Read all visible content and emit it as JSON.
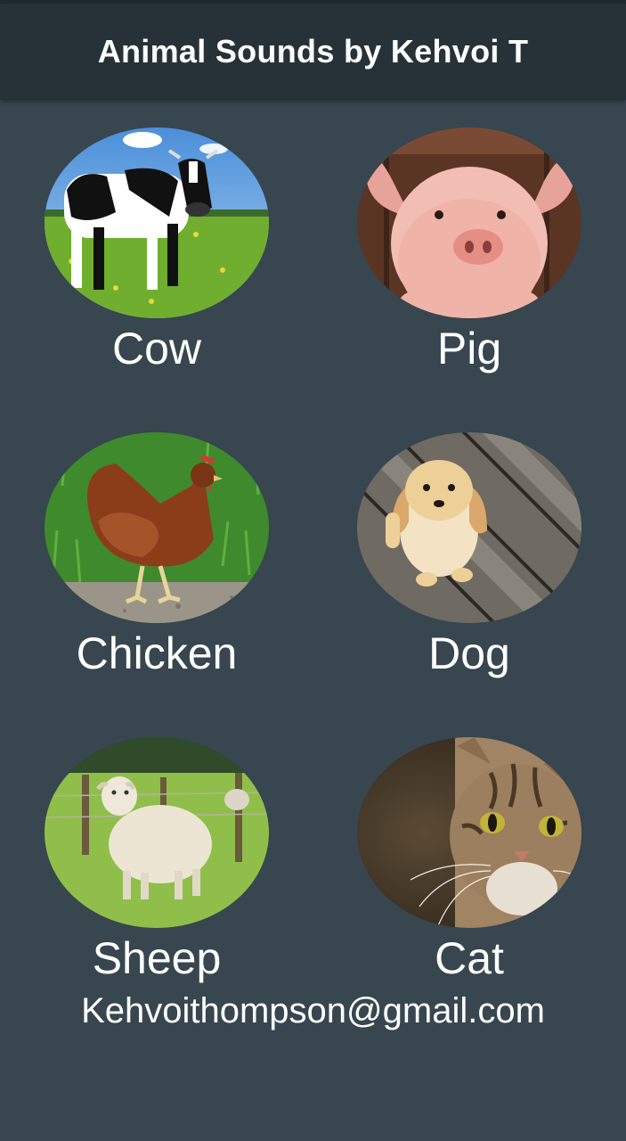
{
  "app": {
    "title": "Animal Sounds by Kehvoi T"
  },
  "animals": [
    {
      "name": "Cow",
      "image": "cow-photo"
    },
    {
      "name": "Pig",
      "image": "pig-photo"
    },
    {
      "name": "Chicken",
      "image": "chicken-photo"
    },
    {
      "name": "Dog",
      "image": "dog-photo"
    },
    {
      "name": "Sheep",
      "image": "sheep-photo"
    },
    {
      "name": "Cat",
      "image": "cat-photo"
    }
  ],
  "footer": {
    "email": "Kehvoithompson@gmail.com"
  },
  "colors": {
    "background": "#37464f",
    "appbar": "#263238",
    "text": "#ffffff"
  }
}
